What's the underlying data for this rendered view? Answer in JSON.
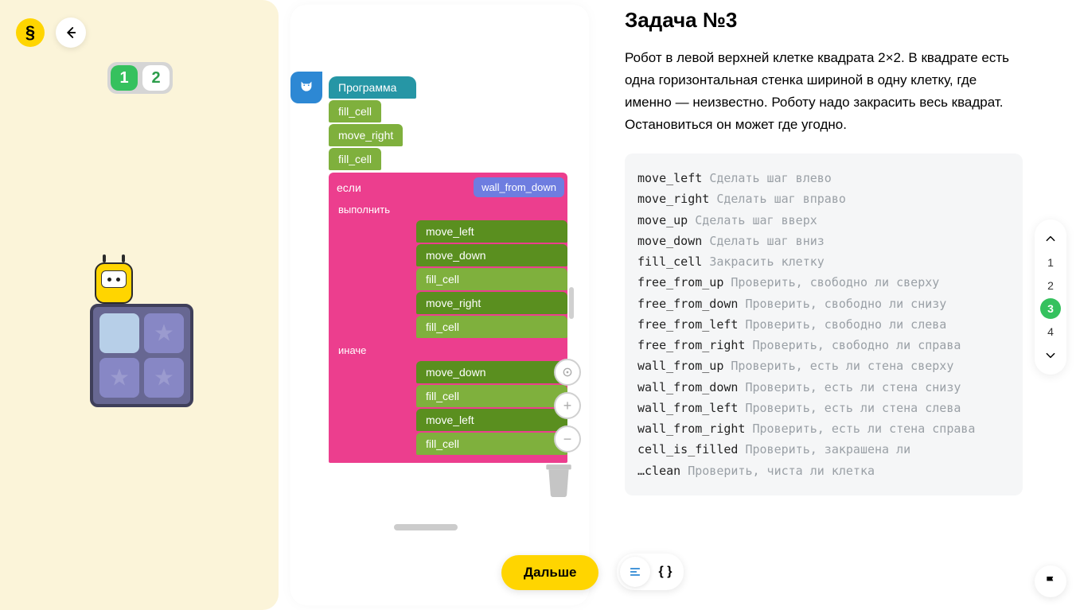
{
  "header": {
    "step_pills": [
      "1",
      "2"
    ],
    "active_pill_index": 0
  },
  "blocks": {
    "program_label": "Программа",
    "pre": [
      "fill_cell",
      "move_right",
      "fill_cell"
    ],
    "if_kw": "если",
    "cond": "wall_from_down",
    "then_kw": "выполнить",
    "then_children": [
      "move_left",
      "move_down",
      "fill_cell",
      "move_right",
      "fill_cell"
    ],
    "else_kw": "иначе",
    "else_children": [
      "move_down",
      "fill_cell",
      "move_left",
      "fill_cell"
    ]
  },
  "next_button": "Дальше",
  "task": {
    "title": "Задача №3",
    "description": "Робот в левой верхней клетке квадрата 2×2. В квадрате есть одна горизонтальная стенка шириной в одну клетку, где именно — неизвестно. Роботу надо закрасить весь квадрат. Остановиться он может где угодно."
  },
  "reference": [
    {
      "cmd": "move_left",
      "desc": "Сделать шаг влево"
    },
    {
      "cmd": "move_right",
      "desc": "Сделать шаг вправо"
    },
    {
      "cmd": "move_up",
      "desc": "Сделать шаг вверх"
    },
    {
      "cmd": "move_down",
      "desc": "Сделать шаг вниз"
    },
    {
      "cmd": "fill_cell",
      "desc": "Закрасить клетку"
    },
    {
      "cmd": "free_from_up",
      "desc": "Проверить, свободно ли сверху"
    },
    {
      "cmd": "free_from_down",
      "desc": "Проверить, свободно ли снизу"
    },
    {
      "cmd": "free_from_left",
      "desc": "Проверить, свободно ли слева"
    },
    {
      "cmd": "free_from_right",
      "desc": "Проверить, свободно ли справа"
    },
    {
      "cmd": "wall_from_up",
      "desc": "Проверить, есть ли стена сверху"
    },
    {
      "cmd": "wall_from_down",
      "desc": "Проверить, есть ли стена снизу"
    },
    {
      "cmd": "wall_from_left",
      "desc": "Проверить, есть ли стена слева"
    },
    {
      "cmd": "wall_from_right",
      "desc": "Проверить, есть ли стена справа"
    },
    {
      "cmd": "cell_is_filled",
      "desc": "Проверить, закрашена ли"
    },
    {
      "cmd": "…clean",
      "desc": "Проверить, чиста ли клетка"
    }
  ],
  "right_nav": {
    "items": [
      "1",
      "2",
      "3",
      "4"
    ],
    "active_index": 2
  }
}
